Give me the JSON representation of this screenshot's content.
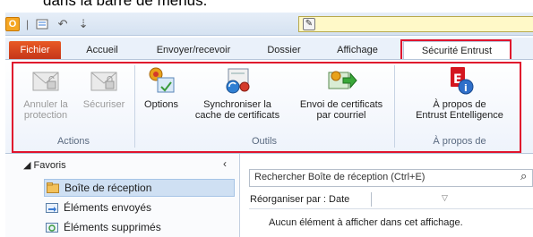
{
  "caption": "dans la barre de menus.",
  "tabs": [
    {
      "label": "Fichier"
    },
    {
      "label": "Accueil"
    },
    {
      "label": "Envoyer/recevoir"
    },
    {
      "label": "Dossier"
    },
    {
      "label": "Affichage"
    },
    {
      "label": "Sécurité Entrust"
    }
  ],
  "ribbon": {
    "groups": [
      {
        "label": "Actions"
      },
      {
        "label": "Outils"
      },
      {
        "label": "À propos de"
      }
    ],
    "buttons": [
      {
        "line1": "Annuler la",
        "line2": "protection",
        "enabled": false
      },
      {
        "line1": "Sécuriser",
        "line2": "",
        "enabled": false
      },
      {
        "line1": "Options",
        "line2": "",
        "enabled": true
      },
      {
        "line1": "Synchroniser la",
        "line2": "cache de certificats",
        "enabled": true
      },
      {
        "line1": "Envoi de certificats",
        "line2": "par courriel",
        "enabled": true
      },
      {
        "line1": "À propos de",
        "line2": "Entrust Entelligence",
        "enabled": true
      }
    ]
  },
  "nav": {
    "header": "Favoris",
    "items": [
      {
        "label": "Boîte de réception",
        "selected": true
      },
      {
        "label": "Éléments envoyés",
        "selected": false
      },
      {
        "label": "Éléments supprimés",
        "selected": false
      }
    ]
  },
  "content": {
    "search_placeholder": "Rechercher Boîte de réception (Ctrl+E)",
    "arrange_label": "Réorganiser par : Date",
    "empty_message": "Aucun élément à afficher dans cet affichage."
  },
  "colors": {
    "highlight": "#e0142d",
    "fichier_tab": "#d8431f",
    "selected_item": "#cfe0f3"
  }
}
